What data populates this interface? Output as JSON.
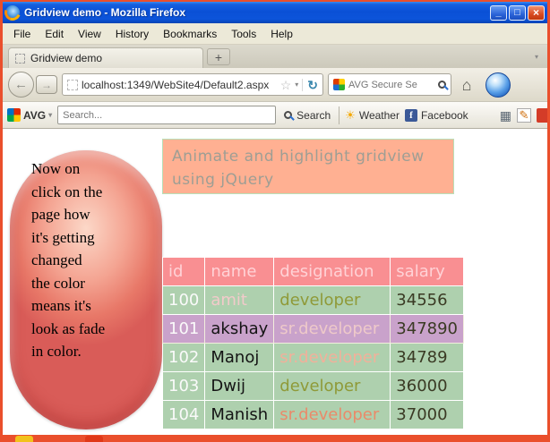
{
  "window": {
    "title": "Gridview demo - Mozilla Firefox"
  },
  "icons": {
    "minimize": "_",
    "maximize": "□",
    "close": "×",
    "back": "←",
    "forward": "→",
    "star": "☆",
    "caret": "▾",
    "refresh": "↻",
    "home": "⌂",
    "sun": "☀",
    "facebook_f": "f",
    "grid": "▦",
    "pencil": "✎"
  },
  "menu": {
    "items": [
      "File",
      "Edit",
      "View",
      "History",
      "Bookmarks",
      "Tools",
      "Help"
    ]
  },
  "tabs": {
    "active_label": "Gridview demo",
    "new_tab_label": "+"
  },
  "navigation": {
    "url": "localhost:1349/WebSite4/Default2.aspx",
    "search_engine": "AVG Secure Se"
  },
  "avg_toolbar": {
    "brand": "AVG",
    "search_placeholder": "Search...",
    "search_label": "Search",
    "weather_label": "Weather",
    "facebook_label": "Facebook"
  },
  "page": {
    "note": "Now on\nclick on the\npage how\nit's getting\nchanged\nthe color\nmeans it's\nlook as fade\nin color.",
    "header": "Animate and highlight gridview\nusing jQuery",
    "table": {
      "columns": [
        "id",
        "name",
        "designation",
        "salary"
      ],
      "rows": [
        {
          "id": "100",
          "name": "amit",
          "designation": "developer",
          "salary": "34556"
        },
        {
          "id": "101",
          "name": "akshay",
          "designation": "sr.developer",
          "salary": "347890"
        },
        {
          "id": "102",
          "name": "Manoj",
          "designation": "sr.developer",
          "salary": "34789"
        },
        {
          "id": "103",
          "name": "Dwij",
          "designation": "developer",
          "salary": "36000"
        },
        {
          "id": "104",
          "name": "Manish",
          "designation": "sr.developer",
          "salary": "37000"
        }
      ]
    }
  },
  "colors": {
    "window_frame": "#ea4f2c",
    "titlebar_blue": "#0a50d6",
    "row_green": "#aed0ae",
    "highlight_purple": "#c9a2cb",
    "table_header_pink": "#f98f92",
    "page_header_bg": "#ffb092",
    "page_header_border": "#b8e0b8",
    "note_bubble_red": "#e87868",
    "facebook_blue": "#3b5998"
  }
}
